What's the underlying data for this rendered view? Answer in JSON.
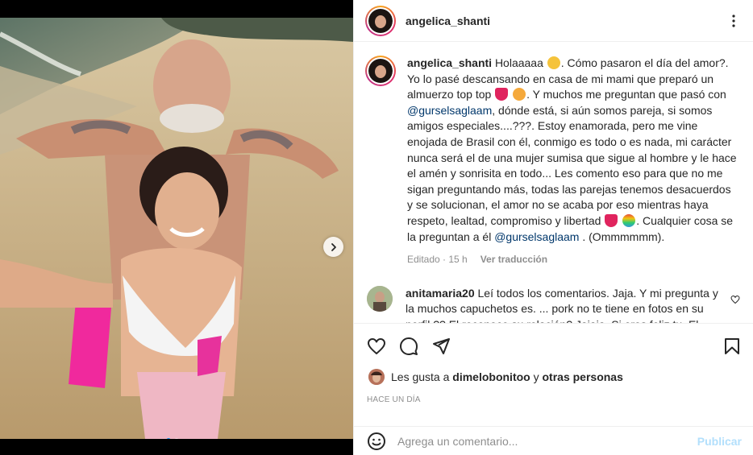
{
  "post": {
    "username": "angelica_shanti",
    "caption": {
      "text_1": "Holaaaaa",
      "text_2": ". Cómo pasaron el día del amor?. Yo lo pasé descansando en casa de mi mami que preparó un almuerzo top top",
      "text_3": ". Y muchos me preguntan que pasó con",
      "mention_1": "@gurselsaglaam",
      "text_4": ", dónde está, si aún somos pareja, si somos amigos especiales....???. Estoy enamorada, pero me vine enojada de Brasil con él, conmigo es todo o es nada, mi carácter nunca será el de una mujer sumisa que sigue al hombre y le hace el amén y sonrisita en todo... Les comento eso para que no me sigan preguntando más, todas las parejas tenemos desacuerdos y se solucionan, el amor no se acaba por eso mientras haya respeto, lealtad, compromiso y libertad",
      "text_5": ". Cualquier cosa se la preguntan a él",
      "mention_2": "@gurselsaglaam",
      "text_6": ". (Ommmmmm).",
      "edited": "Editado · 15 h",
      "translate": "Ver traducción"
    },
    "comment": {
      "username": "anitamaria20",
      "text": "Leí todos los comentarios. Jaja. Y mi pregunta y la muchos capuchetos es. ... pork no te tiene en fotos en su perfil ?? El reconoce su relación? Jajaja. Si eres feliz tu. El resto solo copuchamos jajajajaj , saludos y siga disfrutando"
    },
    "likes": {
      "prefix": "Les gusta a",
      "user": "dimelobonitoo",
      "conj": "y",
      "others": "otras personas"
    },
    "time": "HACE UN DÍA",
    "add_comment": {
      "placeholder": "Agrega un comentario...",
      "post_label": "Publicar"
    },
    "carousel": {
      "slides": 2,
      "active": 1
    },
    "colors": {
      "link": "#00376b",
      "muted": "#8e8e8e",
      "accent": "#0095f6",
      "post_disabled": "#b2dffc"
    },
    "icons": [
      "more-options-icon",
      "heart-icon",
      "comment-icon",
      "share-icon",
      "bookmark-icon",
      "emoji-icon",
      "chevron-right-icon"
    ]
  }
}
